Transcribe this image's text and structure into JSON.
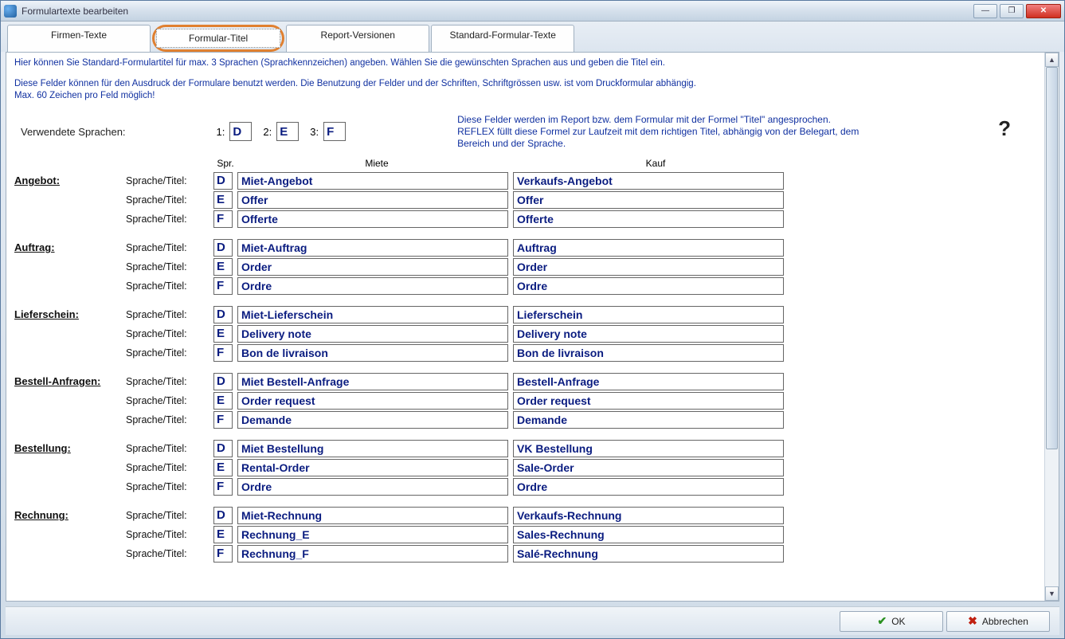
{
  "window": {
    "title": "Formulartexte bearbeiten"
  },
  "tabs": {
    "t0": "Firmen-Texte",
    "t1": "Formular-Titel",
    "t2": "Report-Versionen",
    "t3": "Standard-Formular-Texte"
  },
  "intro": {
    "line1": "Hier können Sie Standard-Formulartitel für max. 3 Sprachen (Sprachkennzeichen) angeben. Wählen Sie die gewünschten Sprachen aus und geben die Titel ein.",
    "line2": "Diese Felder können für den Ausdruck der Formulare benutzt werden. Die Benutzung der Felder und der Schriften, Schriftgrössen usw. ist vom Druckformular abhängig.",
    "line3": "Max. 60 Zeichen pro Feld möglich!"
  },
  "lang": {
    "label": "Verwendete Sprachen:",
    "n1": "1:",
    "v1": "D",
    "n2": "2:",
    "v2": "E",
    "n3": "3:",
    "v3": "F",
    "info": "Diese Felder werden im Report bzw. dem Formular mit der Formel \"Titel\" angesprochen. REFLEX füllt diese Formel zur Laufzeit mit dem richtigen Titel, abhängig von der Belegart, dem Bereich und der Sprache."
  },
  "columns": {
    "spr": "Spr.",
    "miete": "Miete",
    "kauf": "Kauf"
  },
  "sublabel": "Sprache/Titel:",
  "sections": [
    {
      "name": "Angebot:",
      "rows": [
        {
          "spr": "D",
          "miete": "Miet-Angebot",
          "kauf": "Verkaufs-Angebot"
        },
        {
          "spr": "E",
          "miete": "Offer",
          "kauf": "Offer"
        },
        {
          "spr": "F",
          "miete": "Offerte",
          "kauf": "Offerte"
        }
      ]
    },
    {
      "name": "Auftrag:",
      "rows": [
        {
          "spr": "D",
          "miete": "Miet-Auftrag",
          "kauf": "Auftrag"
        },
        {
          "spr": "E",
          "miete": "Order",
          "kauf": "Order"
        },
        {
          "spr": "F",
          "miete": "Ordre",
          "kauf": "Ordre"
        }
      ]
    },
    {
      "name": "Lieferschein:",
      "rows": [
        {
          "spr": "D",
          "miete": "Miet-Lieferschein",
          "kauf": "Lieferschein"
        },
        {
          "spr": "E",
          "miete": "Delivery note",
          "kauf": "Delivery note"
        },
        {
          "spr": "F",
          "miete": "Bon de livraison",
          "kauf": "Bon de livraison"
        }
      ]
    },
    {
      "name": "Bestell-Anfragen:",
      "rows": [
        {
          "spr": "D",
          "miete": "Miet Bestell-Anfrage",
          "kauf": "Bestell-Anfrage"
        },
        {
          "spr": "E",
          "miete": "Order request",
          "kauf": "Order request"
        },
        {
          "spr": "F",
          "miete": "Demande",
          "kauf": "Demande"
        }
      ]
    },
    {
      "name": "Bestellung:",
      "rows": [
        {
          "spr": "D",
          "miete": "Miet Bestellung",
          "kauf": "VK Bestellung"
        },
        {
          "spr": "E",
          "miete": "Rental-Order",
          "kauf": "Sale-Order"
        },
        {
          "spr": "F",
          "miete": "Ordre",
          "kauf": "Ordre"
        }
      ]
    },
    {
      "name": "Rechnung:",
      "rows": [
        {
          "spr": "D",
          "miete": "Miet-Rechnung",
          "kauf": "Verkaufs-Rechnung"
        },
        {
          "spr": "E",
          "miete": "Rechnung_E",
          "kauf": "Sales-Rechnung"
        },
        {
          "spr": "F",
          "miete": "Rechnung_F",
          "kauf": "Salé-Rechnung"
        }
      ]
    }
  ],
  "buttons": {
    "ok": "OK",
    "cancel": "Abbrechen"
  },
  "help": "?"
}
